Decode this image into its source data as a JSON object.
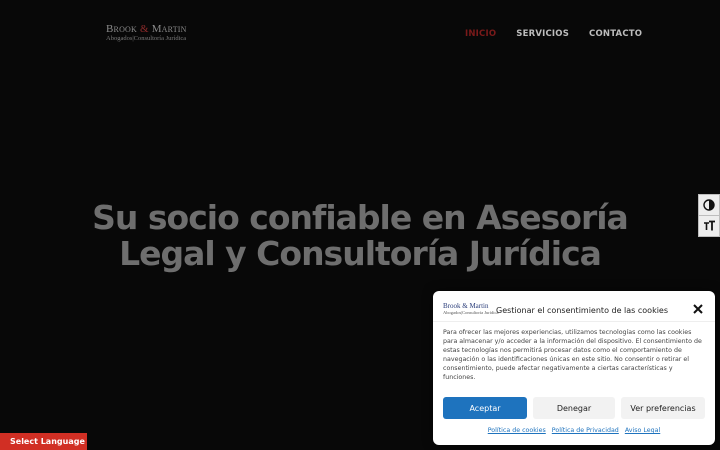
{
  "logo": {
    "brand_left": "Brook",
    "amp": "&",
    "brand_right": "Martin",
    "tagline": "Abogados|Consultoría Jurídica"
  },
  "nav": {
    "items": [
      {
        "label": "INICIO"
      },
      {
        "label": "SERVICIOS"
      },
      {
        "label": "CONTACTO"
      }
    ],
    "active_color": "#7a1a1a"
  },
  "hero": {
    "line1": "Su socio confiable en Asesoría",
    "line2": "Legal y Consultoría Jurídica"
  },
  "accessibility": {
    "contrast_icon": "contrast-icon",
    "font_icon": "text-size-icon"
  },
  "language": {
    "label": "Select Language",
    "color": "#d12f24"
  },
  "cookie": {
    "logo_brand": "Brook & Martin",
    "logo_tagline": "Abogados|Consultoría Jurídica",
    "title": "Gestionar el consentimiento de las cookies",
    "body": "Para ofrecer las mejores experiencias, utilizamos tecnologías como las cookies para almacenar y/o acceder a la información del dispositivo. El consentimiento de estas tecnologías nos permitirá procesar datos como el comportamiento de navegación o las identificaciones únicas en este sitio. No consentir o retirar el consentimiento, puede afectar negativamente a ciertas características y funciones.",
    "accept": "Aceptar",
    "deny": "Denegar",
    "prefs": "Ver preferencias",
    "links": [
      "Política de cookies",
      "Política de Privacidad",
      "Aviso Legal"
    ],
    "accent": "#1e73be"
  }
}
